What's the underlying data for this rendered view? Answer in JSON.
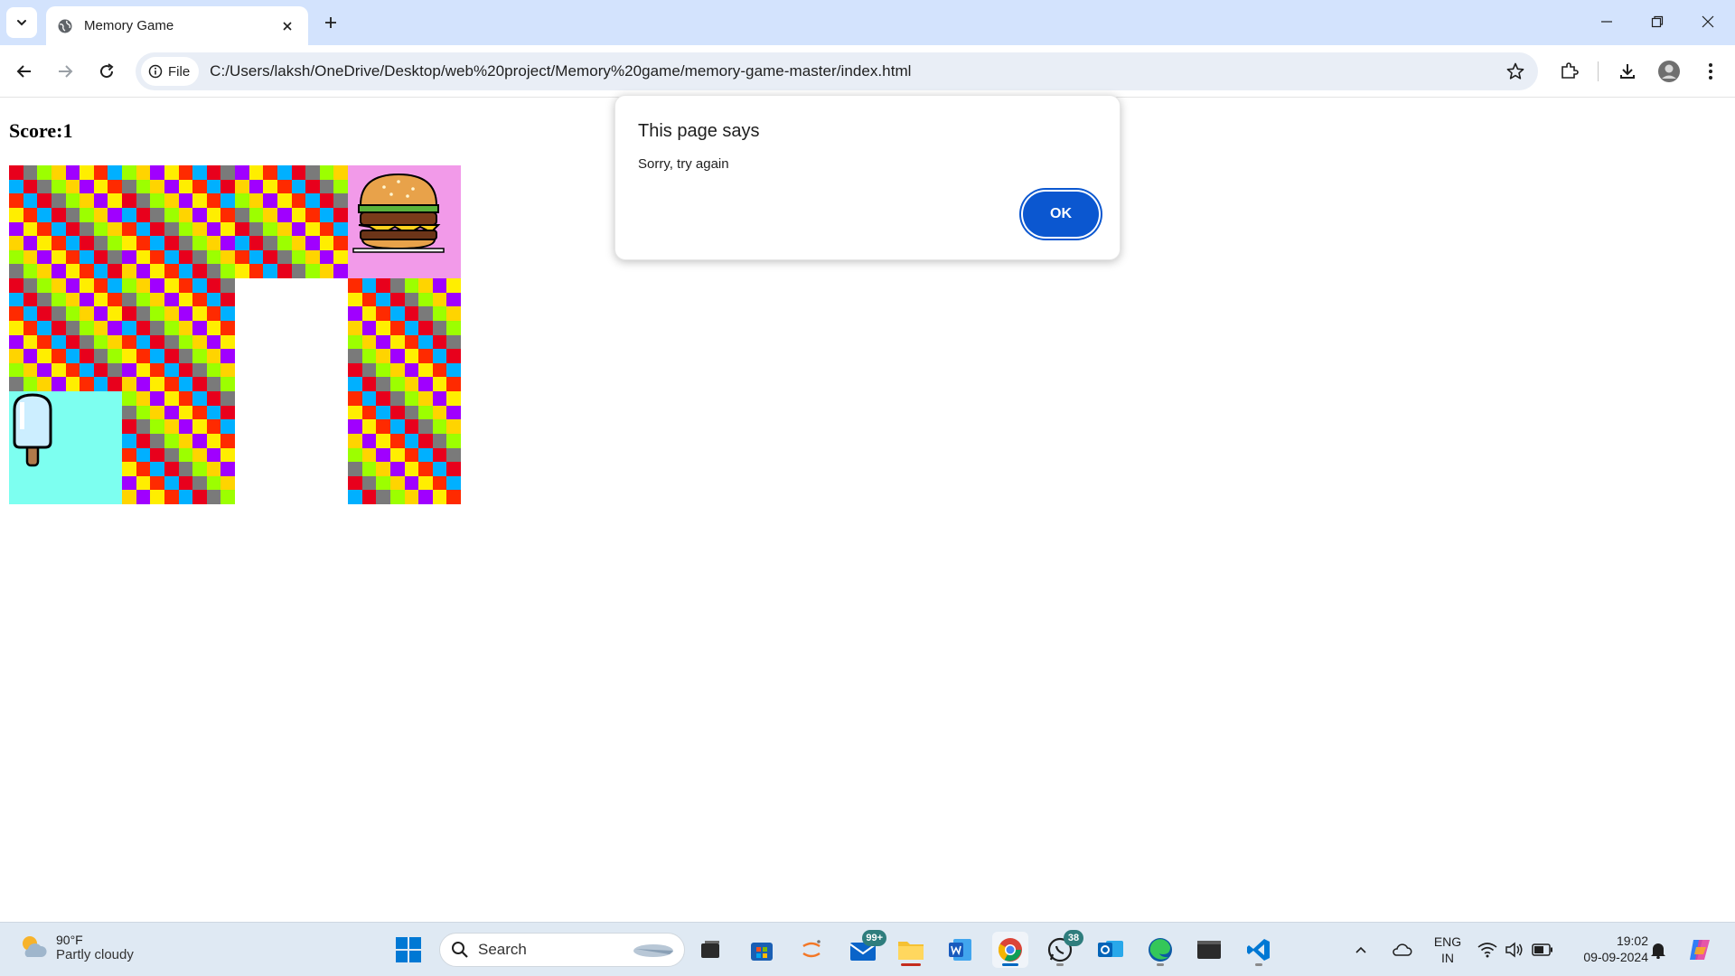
{
  "browser": {
    "tab_title": "Memory Game",
    "chip_label": "File",
    "url": "C:/Users/laksh/OneDrive/Desktop/web%20project/Memory%20game/memory-game-master/index.html"
  },
  "page": {
    "score_label": "Score:1",
    "cards": [
      {
        "state": "back"
      },
      {
        "state": "back"
      },
      {
        "state": "back"
      },
      {
        "state": "face",
        "icon": "burger-icon",
        "color": "#f29ae9"
      },
      {
        "state": "back"
      },
      {
        "state": "back"
      },
      {
        "state": "empty"
      },
      {
        "state": "back"
      },
      {
        "state": "face",
        "icon": "popsicle-icon",
        "color": "#7dfff0"
      },
      {
        "state": "back"
      },
      {
        "state": "empty"
      },
      {
        "state": "back"
      }
    ],
    "card_back_colors": [
      "#e8001c",
      "#ffee00",
      "#9cff00",
      "#00b0ff",
      "#a000ff",
      "#7a7a7a",
      "#ff2a00",
      "#ffd400"
    ]
  },
  "dialog": {
    "title": "This page says",
    "message": "Sorry, try again",
    "ok_label": "OK"
  },
  "taskbar": {
    "weather_temp": "90°F",
    "weather_desc": "Partly cloudy",
    "search_label": "Search",
    "mail_badge": "99+",
    "whatsapp_badge": "38",
    "lang_top": "ENG",
    "lang_bottom": "IN",
    "time": "19:02",
    "date": "09-09-2024"
  },
  "colors": {
    "accent": "#0b57d0",
    "tabstrip": "#d3e3fd",
    "taskbar": "#dfe9f3"
  }
}
